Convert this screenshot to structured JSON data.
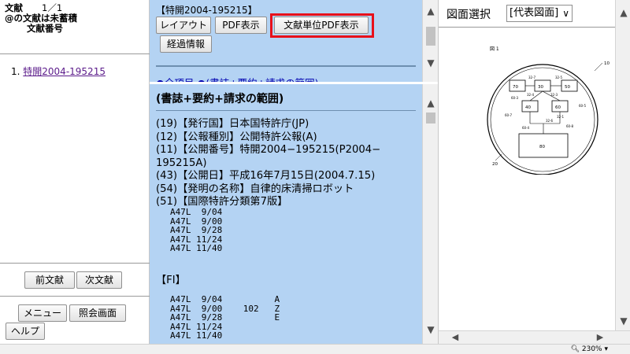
{
  "left": {
    "doc_label": "文献",
    "count": "1／1",
    "line2": "@の文献は未蓄積",
    "line3": "文献番号",
    "list_index": "1.",
    "list_item": "特開2004-195215",
    "prev_button": "前文献",
    "next_button": "次文献",
    "menu_button": "メニュー",
    "query_button": "照会画面",
    "help_button": "ヘルプ"
  },
  "toolbar": {
    "doc_number": "【特開2004-195215】",
    "layout_button": "レイアウト",
    "pdf_button": "PDF表示",
    "unit_pdf_button": "文献単位PDF表示",
    "history_button": "経過情報",
    "cut_off_text": "●全項目 ●(書誌+要約+請求の範囲)"
  },
  "content": {
    "section_title": "(書誌+要約+請求の範囲)",
    "biblio": [
      "(19)【発行国】日本国特許庁(JP)",
      "(12)【公報種別】公開特許公報(A)",
      "(11)【公開番号】特開2004−195215(P2004−",
      "195215A)",
      "(43)【公開日】平成16年7月15日(2004.7.15)",
      "(54)【発明の名称】自律的床清掃ロボット",
      "(51)【国際特許分類第7版】"
    ],
    "ipc": [
      "A47L  9/04",
      "A47L  9/00",
      "A47L  9/28",
      "A47L 11/24",
      "A47L 11/40"
    ],
    "fi_title": "【FI】",
    "fi": [
      "A47L  9/04          A",
      "A47L  9/00    102   Z",
      "A47L  9/28          E",
      "A47L 11/24",
      "A47L 11/40"
    ]
  },
  "right": {
    "figure_label": "図面選択",
    "figure_select": "[代表図面]",
    "figure": {
      "title": "図 1",
      "ref_10": "10",
      "ref_20": "20",
      "boxes": [
        "70",
        "30",
        "50",
        "40",
        "60",
        "80"
      ],
      "refs": [
        "32-7",
        "32-5",
        "32-4",
        "32-3",
        "32-1",
        "60-5",
        "60-7",
        "60-4",
        "32-6",
        "60-8",
        "60-3"
      ]
    }
  },
  "status": {
    "zoom": "230%"
  }
}
